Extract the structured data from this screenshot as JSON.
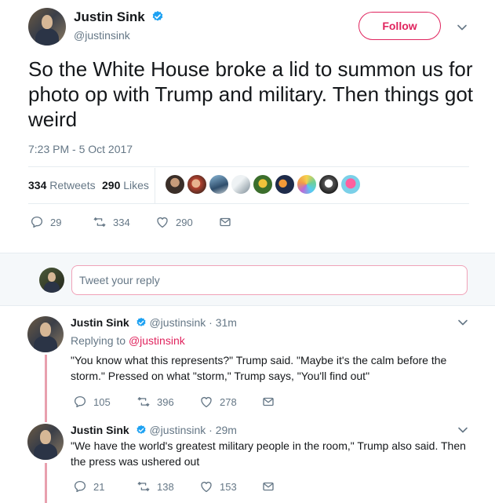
{
  "tweet": {
    "author_name": "Justin Sink",
    "author_handle": "@justinsink",
    "follow_label": "Follow",
    "text": "So the White House broke a lid to summon us for photo op with Trump and military. Then things got weird",
    "timestamp": "7:23 PM - 5 Oct 2017",
    "retweets_count": "334",
    "retweets_label": "Retweets",
    "likes_count": "290",
    "likes_label": "Likes",
    "actions": {
      "replies": "29",
      "retweets": "334",
      "likes": "290"
    }
  },
  "reply_box": {
    "placeholder": "Tweet your reply"
  },
  "replies": [
    {
      "author_name": "Justin Sink",
      "author_handle": "@justinsink",
      "time": "· 31m",
      "replying_prefix": "Replying to",
      "replying_to": "@justinsink",
      "text": "\"You know what this represents?\" Trump said. \"Maybe it's the calm before the storm.\" Pressed on what \"storm,\" Trump says, \"You'll find out\"",
      "actions": {
        "replies": "105",
        "retweets": "396",
        "likes": "278"
      }
    },
    {
      "author_name": "Justin Sink",
      "author_handle": "@justinsink",
      "time": "· 29m",
      "text": "\"We have the world's greatest military people in the room,\" Trump also said. Then the press was ushered out",
      "actions": {
        "replies": "21",
        "retweets": "138",
        "likes": "153"
      }
    }
  ],
  "colors": {
    "accent": "#e0245e",
    "verified": "#1da1f2",
    "muted": "#657786",
    "thread": "#e8a0ae"
  },
  "icons": [
    "verified-badge-icon",
    "chevron-down-icon",
    "reply-icon",
    "retweet-icon",
    "like-icon",
    "direct-message-icon"
  ]
}
